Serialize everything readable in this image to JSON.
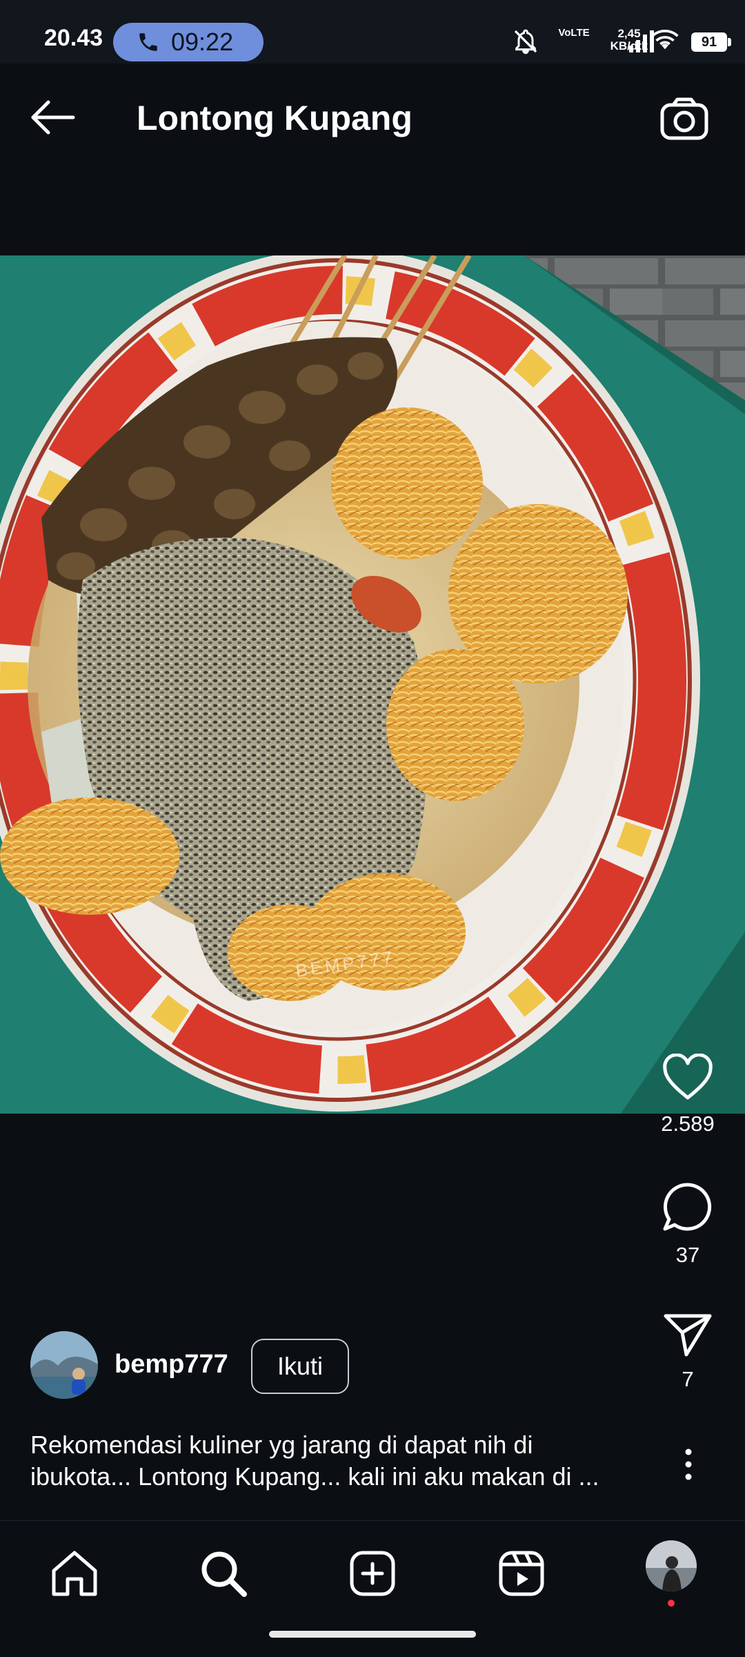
{
  "status_bar": {
    "time": "20.43",
    "call_timer": "09:22",
    "network_label": "VoLTE",
    "speed_value": "2,45",
    "speed_unit": "KB/dtk",
    "battery": "91"
  },
  "header": {
    "title": "Lontong Kupang"
  },
  "post": {
    "image_watermark": "BEMP777",
    "likes": "2.589",
    "comments": "37",
    "shares": "7",
    "username": "bemp777",
    "follow_label": "Ikuti",
    "caption_line1": "Rekomendasi kuliner yg jarang di dapat nih di",
    "caption_line2": "ibukota... Lontong Kupang... kali ini aku makan di ..."
  },
  "icons": {
    "back": "arrow-left-icon",
    "camera": "camera-icon",
    "like": "heart-icon",
    "comment": "comment-icon",
    "share": "send-icon",
    "more": "more-vertical-icon",
    "home": "home-icon",
    "search": "search-icon",
    "create": "add-post-icon",
    "reels": "reels-icon"
  },
  "colors": {
    "background": "#0b0f14",
    "status_bar": "#12161d",
    "call_pill": "#6f8edc",
    "notification_dot": "#ff3040"
  }
}
